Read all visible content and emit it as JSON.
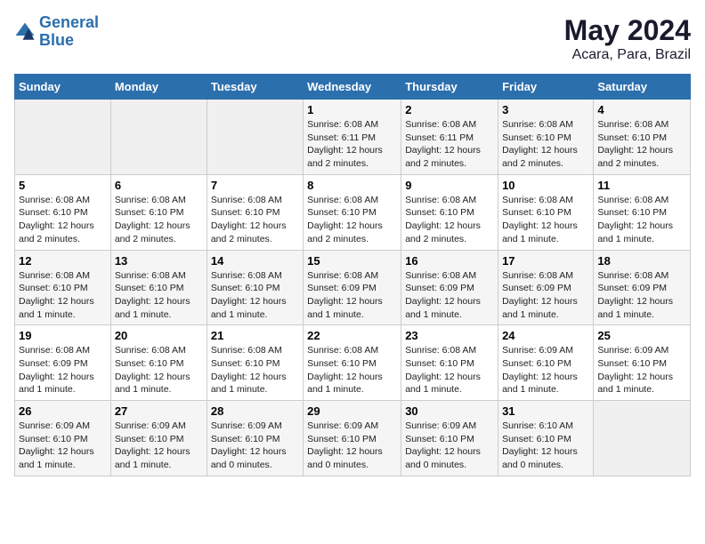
{
  "header": {
    "logo_line1": "General",
    "logo_line2": "Blue",
    "month": "May 2024",
    "location": "Acara, Para, Brazil"
  },
  "weekdays": [
    "Sunday",
    "Monday",
    "Tuesday",
    "Wednesday",
    "Thursday",
    "Friday",
    "Saturday"
  ],
  "weeks": [
    [
      {
        "day": "",
        "info": ""
      },
      {
        "day": "",
        "info": ""
      },
      {
        "day": "",
        "info": ""
      },
      {
        "day": "1",
        "info": "Sunrise: 6:08 AM\nSunset: 6:11 PM\nDaylight: 12 hours\nand 2 minutes."
      },
      {
        "day": "2",
        "info": "Sunrise: 6:08 AM\nSunset: 6:11 PM\nDaylight: 12 hours\nand 2 minutes."
      },
      {
        "day": "3",
        "info": "Sunrise: 6:08 AM\nSunset: 6:10 PM\nDaylight: 12 hours\nand 2 minutes."
      },
      {
        "day": "4",
        "info": "Sunrise: 6:08 AM\nSunset: 6:10 PM\nDaylight: 12 hours\nand 2 minutes."
      }
    ],
    [
      {
        "day": "5",
        "info": "Sunrise: 6:08 AM\nSunset: 6:10 PM\nDaylight: 12 hours\nand 2 minutes."
      },
      {
        "day": "6",
        "info": "Sunrise: 6:08 AM\nSunset: 6:10 PM\nDaylight: 12 hours\nand 2 minutes."
      },
      {
        "day": "7",
        "info": "Sunrise: 6:08 AM\nSunset: 6:10 PM\nDaylight: 12 hours\nand 2 minutes."
      },
      {
        "day": "8",
        "info": "Sunrise: 6:08 AM\nSunset: 6:10 PM\nDaylight: 12 hours\nand 2 minutes."
      },
      {
        "day": "9",
        "info": "Sunrise: 6:08 AM\nSunset: 6:10 PM\nDaylight: 12 hours\nand 2 minutes."
      },
      {
        "day": "10",
        "info": "Sunrise: 6:08 AM\nSunset: 6:10 PM\nDaylight: 12 hours\nand 1 minute."
      },
      {
        "day": "11",
        "info": "Sunrise: 6:08 AM\nSunset: 6:10 PM\nDaylight: 12 hours\nand 1 minute."
      }
    ],
    [
      {
        "day": "12",
        "info": "Sunrise: 6:08 AM\nSunset: 6:10 PM\nDaylight: 12 hours\nand 1 minute."
      },
      {
        "day": "13",
        "info": "Sunrise: 6:08 AM\nSunset: 6:10 PM\nDaylight: 12 hours\nand 1 minute."
      },
      {
        "day": "14",
        "info": "Sunrise: 6:08 AM\nSunset: 6:10 PM\nDaylight: 12 hours\nand 1 minute."
      },
      {
        "day": "15",
        "info": "Sunrise: 6:08 AM\nSunset: 6:09 PM\nDaylight: 12 hours\nand 1 minute."
      },
      {
        "day": "16",
        "info": "Sunrise: 6:08 AM\nSunset: 6:09 PM\nDaylight: 12 hours\nand 1 minute."
      },
      {
        "day": "17",
        "info": "Sunrise: 6:08 AM\nSunset: 6:09 PM\nDaylight: 12 hours\nand 1 minute."
      },
      {
        "day": "18",
        "info": "Sunrise: 6:08 AM\nSunset: 6:09 PM\nDaylight: 12 hours\nand 1 minute."
      }
    ],
    [
      {
        "day": "19",
        "info": "Sunrise: 6:08 AM\nSunset: 6:09 PM\nDaylight: 12 hours\nand 1 minute."
      },
      {
        "day": "20",
        "info": "Sunrise: 6:08 AM\nSunset: 6:10 PM\nDaylight: 12 hours\nand 1 minute."
      },
      {
        "day": "21",
        "info": "Sunrise: 6:08 AM\nSunset: 6:10 PM\nDaylight: 12 hours\nand 1 minute."
      },
      {
        "day": "22",
        "info": "Sunrise: 6:08 AM\nSunset: 6:10 PM\nDaylight: 12 hours\nand 1 minute."
      },
      {
        "day": "23",
        "info": "Sunrise: 6:08 AM\nSunset: 6:10 PM\nDaylight: 12 hours\nand 1 minute."
      },
      {
        "day": "24",
        "info": "Sunrise: 6:09 AM\nSunset: 6:10 PM\nDaylight: 12 hours\nand 1 minute."
      },
      {
        "day": "25",
        "info": "Sunrise: 6:09 AM\nSunset: 6:10 PM\nDaylight: 12 hours\nand 1 minute."
      }
    ],
    [
      {
        "day": "26",
        "info": "Sunrise: 6:09 AM\nSunset: 6:10 PM\nDaylight: 12 hours\nand 1 minute."
      },
      {
        "day": "27",
        "info": "Sunrise: 6:09 AM\nSunset: 6:10 PM\nDaylight: 12 hours\nand 1 minute."
      },
      {
        "day": "28",
        "info": "Sunrise: 6:09 AM\nSunset: 6:10 PM\nDaylight: 12 hours\nand 0 minutes."
      },
      {
        "day": "29",
        "info": "Sunrise: 6:09 AM\nSunset: 6:10 PM\nDaylight: 12 hours\nand 0 minutes."
      },
      {
        "day": "30",
        "info": "Sunrise: 6:09 AM\nSunset: 6:10 PM\nDaylight: 12 hours\nand 0 minutes."
      },
      {
        "day": "31",
        "info": "Sunrise: 6:10 AM\nSunset: 6:10 PM\nDaylight: 12 hours\nand 0 minutes."
      },
      {
        "day": "",
        "info": ""
      }
    ]
  ]
}
